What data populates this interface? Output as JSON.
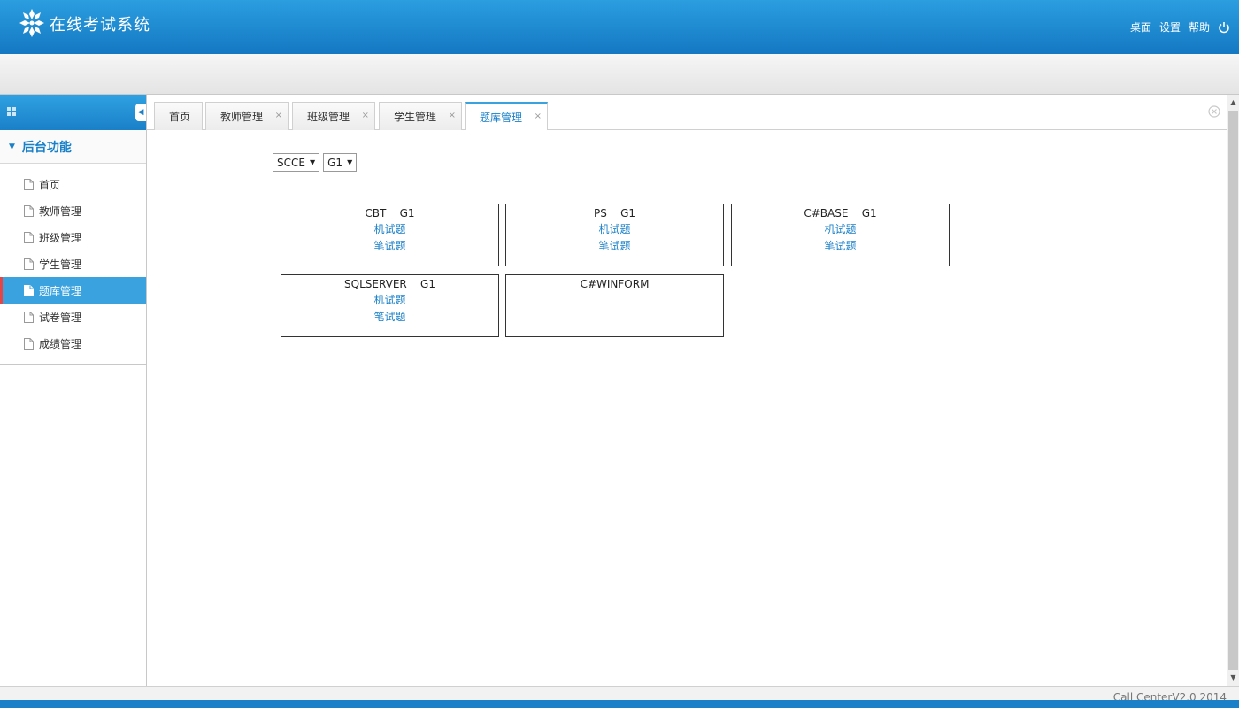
{
  "header": {
    "title": "在线考试系统",
    "links": [
      "桌面",
      "设置",
      "帮助"
    ]
  },
  "sidebar": {
    "section_title": "后台功能",
    "items": [
      {
        "label": "首页"
      },
      {
        "label": "教师管理"
      },
      {
        "label": "班级管理"
      },
      {
        "label": "学生管理"
      },
      {
        "label": "题库管理",
        "active": true
      },
      {
        "label": "试卷管理"
      },
      {
        "label": "成绩管理"
      }
    ]
  },
  "tabs": [
    {
      "label": "首页",
      "closable": false
    },
    {
      "label": "教师管理",
      "closable": true
    },
    {
      "label": "班级管理",
      "closable": true
    },
    {
      "label": "学生管理",
      "closable": true
    },
    {
      "label": "题库管理",
      "closable": true,
      "active": true
    }
  ],
  "tab_close_symbol": "×",
  "filters": {
    "course": "SCCE",
    "grade": "G1"
  },
  "cards": [
    {
      "title": "CBT    G1",
      "links": [
        "机试题",
        "笔试题"
      ]
    },
    {
      "title": "PS    G1",
      "links": [
        "机试题",
        "笔试题"
      ]
    },
    {
      "title": "C#BASE    G1",
      "links": [
        "机试题",
        "笔试题"
      ]
    },
    {
      "title": "SQLSERVER    G1",
      "links": [
        "机试题",
        "笔试题"
      ]
    },
    {
      "title": "C#WINFORM",
      "links": []
    }
  ],
  "footer": {
    "text": "Call CenterV2.0 2014"
  },
  "colors": {
    "brand": "#1a80c8",
    "active_menu": "#3aa3df",
    "active_marker": "#e64545"
  }
}
